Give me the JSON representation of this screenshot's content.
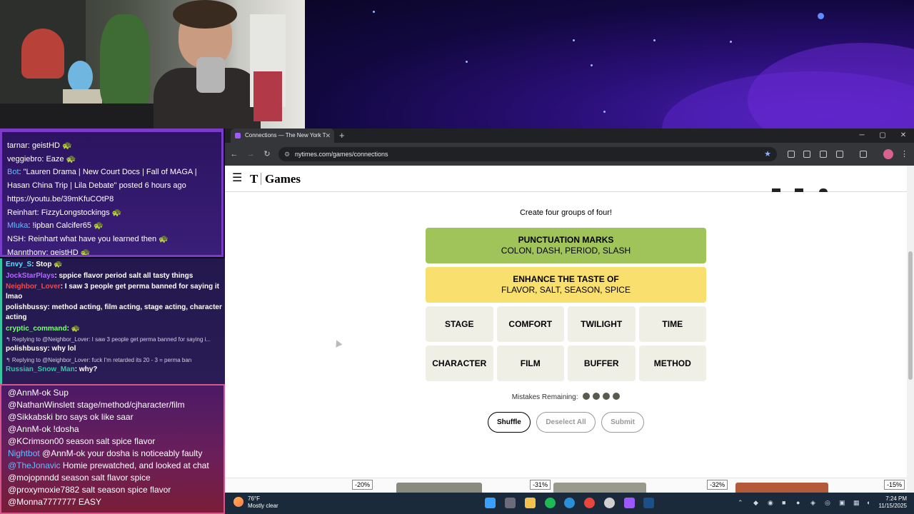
{
  "chat_top": {
    "messages": [
      {
        "user": "tarnar",
        "text": ": geistHD 🐢",
        "user_color": "#ffffff"
      },
      {
        "user": "veggiebro",
        "text": ": Eaze 🐢",
        "user_color": "#ffffff"
      },
      {
        "user": "Bot",
        "text": ": \"Lauren Drama | New Court Docs | Fall of MAGA | Hasan China Trip | Lila Debate\" posted 6 hours ago",
        "user_color": "#6db8ff"
      },
      {
        "user": "",
        "text": "https://youtu.be/39mKfuCOtP8",
        "user_color": "#6db8ff"
      },
      {
        "user": "Reinhart",
        "text": ": FizzyLongstockings 🐢",
        "user_color": "#ffffff"
      },
      {
        "user": "Mluka",
        "text": ": !ipban Calcifer65 🐢",
        "user_color": "#6db8ff"
      },
      {
        "user": "NSH",
        "text": ": Reinhart what have you learned then 🐢",
        "user_color": "#ffffff"
      },
      {
        "user": "Mannthony",
        "text": ": geistHD 🐢",
        "user_color": "#ffffff"
      }
    ]
  },
  "chat_mid": {
    "messages": [
      {
        "user": "Envy_S",
        "text": ": Stop 🐢",
        "user_color": "#5fe0ff",
        "wrap": false
      },
      {
        "user": "JockStarPlays",
        "text": ": sppice flavor period salt all tasty things",
        "user_color": "#b06bff",
        "wrap": false
      },
      {
        "user": "Neighbor_Lover",
        "text": ": I saw 3 people get perma banned for saying it lmao",
        "user_color": "#ff4444",
        "wrap": true
      },
      {
        "user": "polishbussy",
        "text": ": method acting, film acting, stage acting, character acting",
        "user_color": "#ffffff",
        "wrap": true
      },
      {
        "user": "cryptic_command",
        "text": ": 🐢",
        "user_color": "#7cff7c",
        "wrap": false
      },
      {
        "reply": "↰ Replying to @Neighbor_Lover: I saw 3 people get perma banned for saying i..."
      },
      {
        "user": "polishbussy",
        "text": ": why lol",
        "user_color": "#ffffff",
        "wrap": false
      },
      {
        "reply": "↰ Replying to @Neighbor_Lover: fuck I'm retarded its 20 - 3 = perma ban"
      },
      {
        "user": "Russian_Snow_Man",
        "text": ": why?",
        "user_color": "#36c6a0",
        "wrap": false
      }
    ]
  },
  "chat_bottom": {
    "messages": [
      {
        "user": "@AnnM-ok",
        "text": " Sup",
        "user_color": "#ffffff"
      },
      {
        "user": "@NathanWinslett",
        "text": " stage/method/cjharacter/film",
        "user_color": "#ffffff"
      },
      {
        "user": "@Sikkabski",
        "text": " bro says ok like saar",
        "user_color": "#ffffff"
      },
      {
        "user": "@AnnM-ok",
        "text": " !dosha",
        "user_color": "#ffffff"
      },
      {
        "user": "@KCrimson00",
        "text": " season salt spice flavor",
        "user_color": "#ffffff"
      },
      {
        "user": "Nightbot",
        "text": " @AnnM-ok your dosha is noticeably faulty",
        "user_color": "#6db8ff"
      },
      {
        "user": "@TheJonavic",
        "text": " Homie prewatched, and looked at chat",
        "user_color": "#6db8ff"
      },
      {
        "user": "@mojopnndd",
        "text": " season salt flavor spice",
        "user_color": "#ffffff"
      },
      {
        "user": "@proxymoxie7882",
        "text": " salt season spice flavor",
        "user_color": "#ffffff"
      },
      {
        "user": "@Monna7777777",
        "text": " EASY",
        "user_color": "#ffffff"
      }
    ]
  },
  "browser": {
    "tab_title": "Connections — The New York T",
    "url": "nytimes.com/games/connections",
    "new_tab": "+",
    "minimize": "─",
    "maximize": "▢",
    "close": "✕"
  },
  "page": {
    "logo_text": "Games",
    "subtitle": "Create four groups of four!",
    "solved": [
      {
        "category": "PUNCTUATION MARKS",
        "words": "COLON, DASH, PERIOD, SLASH",
        "color": "#a0c35a"
      },
      {
        "category": "ENHANCE THE TASTE OF",
        "words": "FLAVOR, SALT, SEASON, SPICE",
        "color": "#f9df6d"
      }
    ],
    "cards": [
      [
        "STAGE",
        "COMFORT",
        "TWILIGHT",
        "TIME"
      ],
      [
        "CHARACTER",
        "FILM",
        "BUFFER",
        "METHOD"
      ]
    ],
    "mistakes_label": "Mistakes Remaining:",
    "mistakes_remaining": 4,
    "buttons": {
      "shuffle": "Shuffle",
      "deselect": "Deselect All",
      "submit": "Submit"
    },
    "ad_tags": [
      "-20%",
      "-31%",
      "-32%",
      "-15%"
    ]
  },
  "taskbar": {
    "temp": "76°F",
    "weather": "Mostly clear",
    "time": "7:24 PM",
    "date": "11/15/2025"
  }
}
